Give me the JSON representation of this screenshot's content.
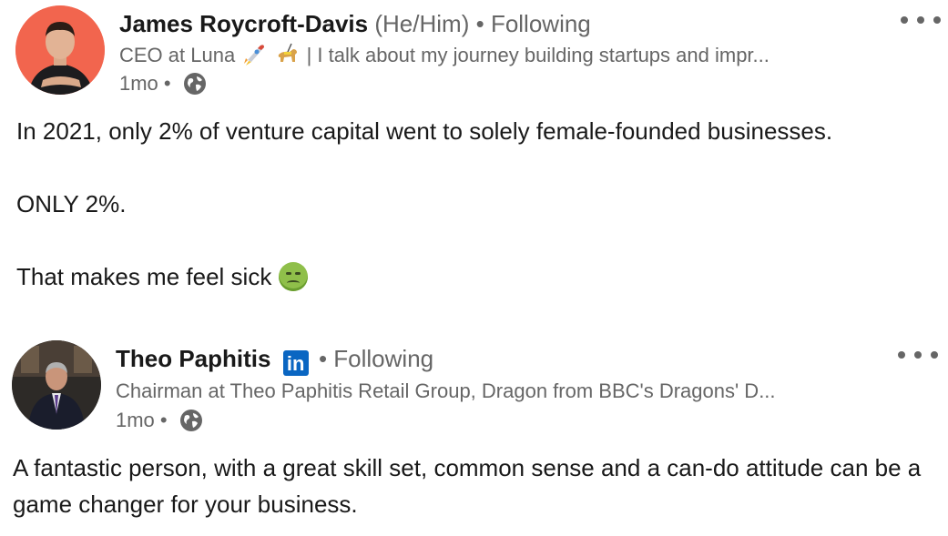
{
  "posts": [
    {
      "author": {
        "name": "James Roycroft-Davis",
        "pronouns": "(He/Him)",
        "connection_separator": "•",
        "connection": "Following",
        "headline_prefix": "CEO at Luna",
        "headline_suffix": "| I talk about my journey building startups and impr...",
        "headline_icons": [
          "rocket-emoji",
          "guide-dog-emoji"
        ],
        "avatar_bg": "#f2654e"
      },
      "time": "1mo",
      "time_separator": "•",
      "visibility_icon": "globe-icon",
      "paragraphs": [
        "In 2021, only 2% of venture capital went to solely female-founded businesses.",
        "ONLY 2%.",
        "That makes me feel sick"
      ],
      "trailing_emoji": "nauseated-face-emoji"
    },
    {
      "author": {
        "name": "Theo Paphitis",
        "badge": "in",
        "connection_separator": "•",
        "connection": "Following",
        "headline": "Chairman at Theo Paphitis Retail Group, Dragon from BBC's Dragons' D...",
        "avatar_bg": "#2d2a27"
      },
      "time": "1mo",
      "time_separator": "•",
      "visibility_icon": "globe-icon",
      "paragraphs": [
        "A fantastic person, with a great skill set, common sense and a can-do attitude can be a game changer for your business."
      ]
    }
  ],
  "colors": {
    "text_primary": "#191919",
    "text_secondary": "#666666",
    "linkedin_blue": "#0a66c2"
  }
}
